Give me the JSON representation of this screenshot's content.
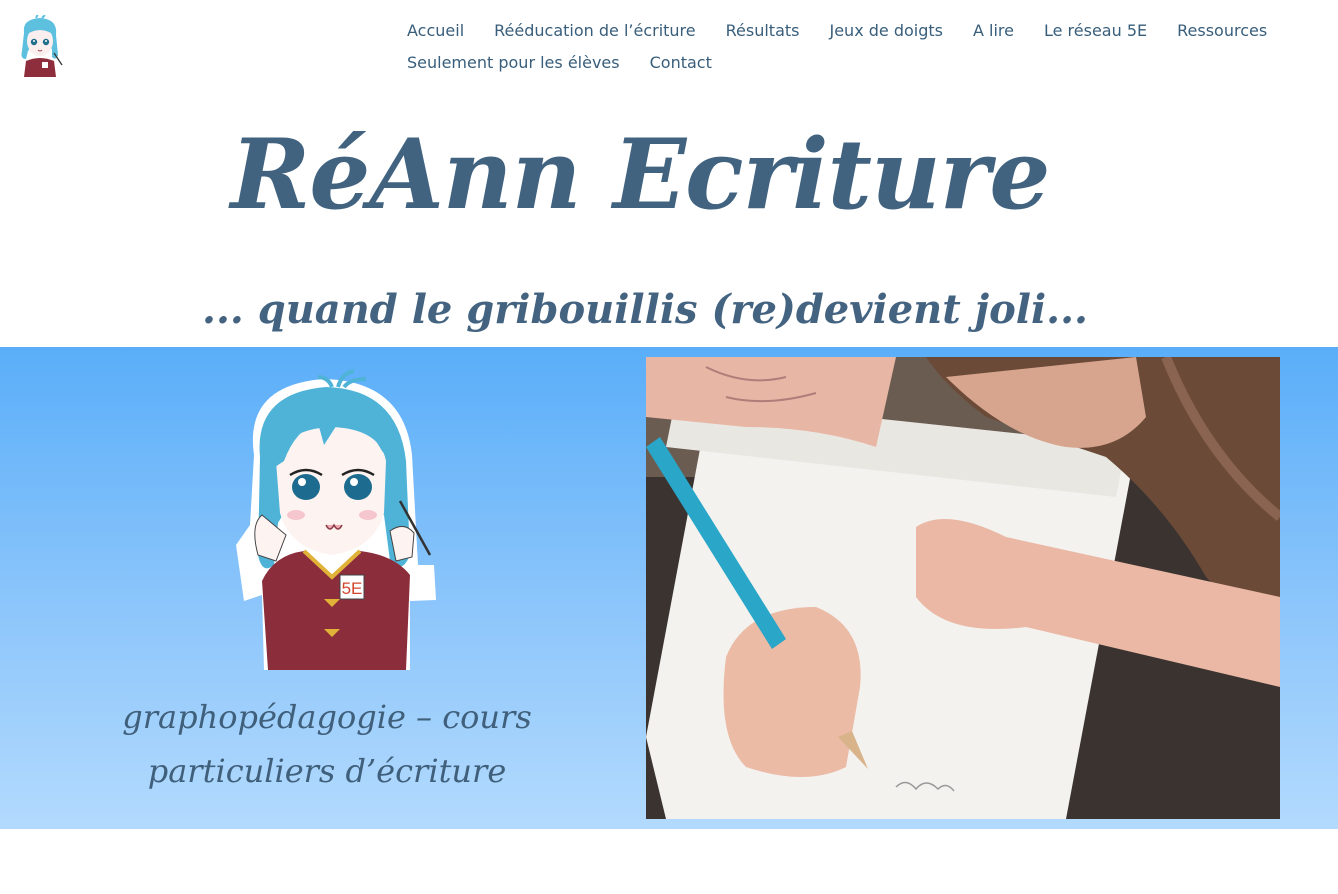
{
  "nav": {
    "items": [
      {
        "label": "Accueil"
      },
      {
        "label": "Rééducation de l’écriture"
      },
      {
        "label": "Résultats"
      },
      {
        "label": "Jeux de doigts"
      },
      {
        "label": "A lire"
      },
      {
        "label": "Le réseau 5E"
      },
      {
        "label": "Ressources"
      },
      {
        "label": "Seulement pour les élèves"
      },
      {
        "label": "Contact"
      }
    ]
  },
  "header": {
    "title": "RéAnn Ecriture",
    "tagline": "... quand le gribouillis (re)devient joli..."
  },
  "hero": {
    "caption_line1": "graphopédagogie – cours",
    "caption_line2": "particuliers d’écriture",
    "badge_text": "5E"
  },
  "colors": {
    "nav_text": "#385e7b",
    "title": "#416380",
    "hero_top": "#5aaef9",
    "hero_bottom": "#b3dafe"
  }
}
